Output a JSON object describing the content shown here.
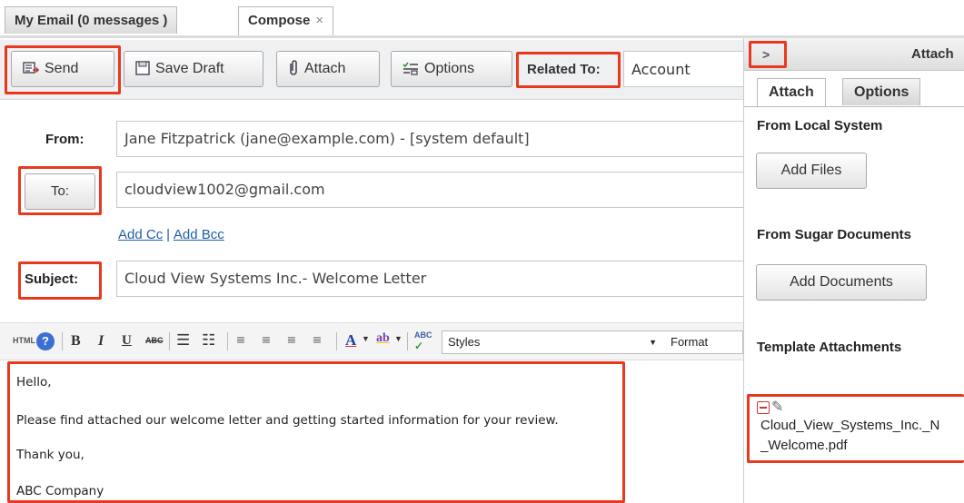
{
  "tabs": {
    "my_email": "My Email (0 messages )",
    "compose": "Compose",
    "close_symbol": "×"
  },
  "toolbar": {
    "send": "Send",
    "save_draft": "Save Draft",
    "attach": "Attach",
    "options": "Options",
    "related_to_label": "Related To:",
    "related_to_value": "Account"
  },
  "form": {
    "from_label": "From:",
    "from_value": "Jane Fitzpatrick (jane@example.com) - [system default]",
    "to_button": "To:",
    "to_value": "cloudview1002@gmail.com",
    "add_cc": "Add Cc",
    "cc_bcc_sep": "|",
    "add_bcc": "Add Bcc",
    "subject_label": "Subject:",
    "subject_value": "Cloud View Systems Inc.- Welcome Letter"
  },
  "editor": {
    "html_label": "HTML",
    "styles": "Styles",
    "format": "Format",
    "body": [
      "Hello,",
      "Please find attached our welcome letter and getting started information for your review.",
      "Thank you,",
      "ABC Company"
    ]
  },
  "panel": {
    "toggle": ">",
    "title": "Attach",
    "tab_attach": "Attach",
    "tab_options": "Options",
    "from_local": "From Local System",
    "add_files": "Add Files",
    "from_sugar": "From Sugar Documents",
    "add_documents": "Add Documents",
    "template_attachments": "Template Attachments",
    "attachment_line1": "Cloud_View_Systems_Inc._N",
    "attachment_line2": "_Welcome.pdf"
  },
  "colors": {
    "highlight": "#e8391f",
    "link": "#1f5fa8",
    "toolbar_bg": "#eef0f2"
  }
}
